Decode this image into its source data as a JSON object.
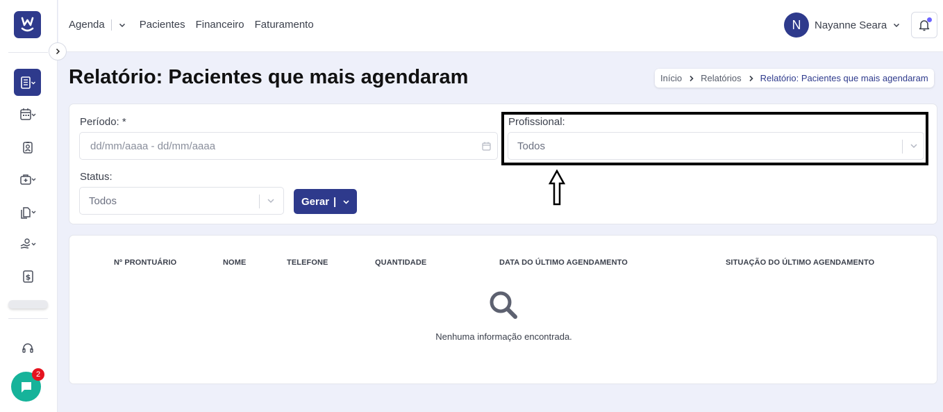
{
  "app": {
    "logo_icon": "w-smile-logo",
    "brand_color": "#2e3a8c"
  },
  "topbar": {
    "nav": [
      "Agenda",
      "Pacientes",
      "Financeiro",
      "Faturamento"
    ],
    "user": {
      "initial": "N",
      "name": "Nayanne Seara"
    }
  },
  "sidebar": {
    "items": [
      {
        "icon": "reports-icon",
        "active": true
      },
      {
        "icon": "calendar-icon"
      },
      {
        "icon": "patient-badge-icon"
      },
      {
        "icon": "medical-case-icon"
      },
      {
        "icon": "documents-icon"
      },
      {
        "icon": "hand-coin-icon"
      },
      {
        "icon": "dollar-icon"
      },
      {
        "icon": "headset-icon"
      }
    ],
    "chat_badge": "2"
  },
  "page": {
    "title": "Relatório: Pacientes que mais agendaram",
    "breadcrumb": [
      "Início",
      "Relatórios",
      "Relatório: Pacientes que mais agendaram"
    ]
  },
  "filters": {
    "periodo_label": "Período: *",
    "periodo_placeholder": "dd/mm/aaaa - dd/mm/aaaa",
    "profissional_label": "Profissional:",
    "profissional_value": "Todos",
    "status_label": "Status:",
    "status_value": "Todos",
    "gerar_label": "Gerar",
    "gerar_separator": "|"
  },
  "table": {
    "columns": [
      "Nº PRONTUÁRIO",
      "NOME",
      "TELEFONE",
      "QUANTIDADE",
      "DATA DO ÚLTIMO AGENDAMENTO",
      "SITUAÇÃO DO ÚLTIMO AGENDAMENTO"
    ],
    "empty_message": "Nenhuma informação encontrada."
  }
}
